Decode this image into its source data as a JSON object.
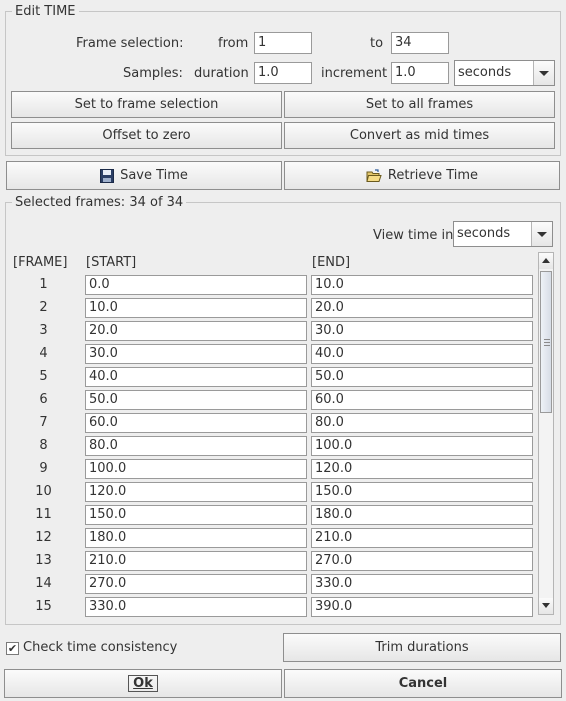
{
  "edit_time": {
    "title": "Edit TIME",
    "frame_selection_label": "Frame selection:",
    "from_label": "from",
    "from_value": "1",
    "to_label": "to",
    "to_value": "34",
    "samples_label": "Samples:",
    "duration_label": "duration",
    "duration_value": "1.0",
    "increment_label": "increment",
    "increment_value": "1.0",
    "unit_selected": "seconds",
    "set_to_frame_selection": "Set to frame selection",
    "set_to_all_frames": "Set to all frames",
    "offset_to_zero": "Offset to zero",
    "convert_as_mid_times": "Convert as mid times"
  },
  "toolbar": {
    "save_time": "Save Time",
    "retrieve_time": "Retrieve Time",
    "save_icon": "floppy-disk-icon",
    "retrieve_icon": "open-folder-icon"
  },
  "selected": {
    "title": "Selected frames: 34 of 34",
    "view_time_label": "View time in",
    "view_time_selected": "seconds",
    "columns": [
      "[FRAME]",
      "[START]",
      "[END]"
    ],
    "rows": [
      {
        "frame": "1",
        "start": "0.0",
        "end": "10.0"
      },
      {
        "frame": "2",
        "start": "10.0",
        "end": "20.0"
      },
      {
        "frame": "3",
        "start": "20.0",
        "end": "30.0"
      },
      {
        "frame": "4",
        "start": "30.0",
        "end": "40.0"
      },
      {
        "frame": "5",
        "start": "40.0",
        "end": "50.0"
      },
      {
        "frame": "6",
        "start": "50.0",
        "end": "60.0"
      },
      {
        "frame": "7",
        "start": "60.0",
        "end": "80.0"
      },
      {
        "frame": "8",
        "start": "80.0",
        "end": "100.0"
      },
      {
        "frame": "9",
        "start": "100.0",
        "end": "120.0"
      },
      {
        "frame": "10",
        "start": "120.0",
        "end": "150.0"
      },
      {
        "frame": "11",
        "start": "150.0",
        "end": "180.0"
      },
      {
        "frame": "12",
        "start": "180.0",
        "end": "210.0"
      },
      {
        "frame": "13",
        "start": "210.0",
        "end": "270.0"
      },
      {
        "frame": "14",
        "start": "270.0",
        "end": "330.0"
      },
      {
        "frame": "15",
        "start": "330.0",
        "end": "390.0"
      }
    ]
  },
  "bottom": {
    "check_time_consistency": "Check time consistency",
    "check_time_consistency_checked": true,
    "trim_durations": "Trim durations",
    "ok": "Ok",
    "cancel": "Cancel"
  }
}
